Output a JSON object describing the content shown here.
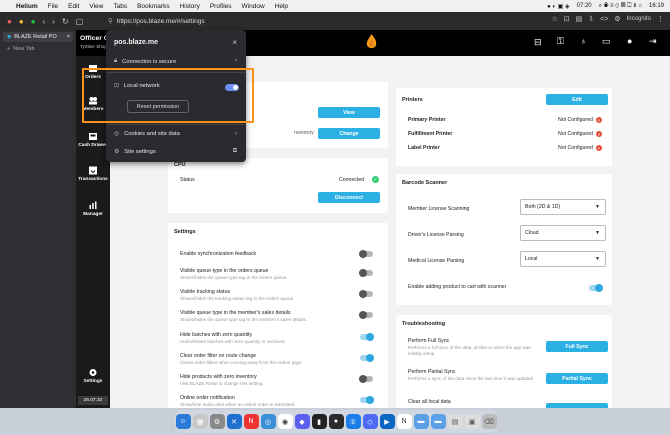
{
  "menubar": {
    "app": "Helium",
    "items": [
      "File",
      "Edit",
      "View",
      "Tabs",
      "Bookmarks",
      "History",
      "Profiles",
      "Window",
      "Help"
    ],
    "right": {
      "time_left": "07:20",
      "time_right": "16:19"
    }
  },
  "browser": {
    "url": "https://pos.blaze.me/#/settings",
    "profile": "Incognito",
    "tab_title": "BLAZE Retail PO",
    "new_tab": "New Tab"
  },
  "popup": {
    "site": "pos.blaze.me",
    "connection": "Connection is secure",
    "local_network": "Local network",
    "reset": "Reset permission",
    "cookies": "Cookies and site data",
    "site_settings": "Site settings"
  },
  "app": {
    "store_name": "Officer C",
    "store_sub": "Tymber Shop",
    "nav": {
      "orders": "Orders",
      "members": "Members",
      "cash_drawer": "Cash Drawer",
      "transactions": "Transactions",
      "manager": "Manager",
      "settings": "Settings",
      "version": "26.07.32"
    },
    "top_card": {
      "view": "View",
      "change": "Change",
      "inventory_text": "nventory"
    },
    "cpu": {
      "title": "CPU",
      "status_label": "Status",
      "status_value": "Connected",
      "disconnect": "Disconnect"
    },
    "settings": {
      "title": "Settings",
      "items": [
        {
          "label": "Enable synchronization feedback",
          "sub": "",
          "on": false
        },
        {
          "label": "Visible queue type in the orders queue",
          "sub": "Shows/hides the queue type tag in the orders queue.",
          "on": false
        },
        {
          "label": "Visible tracking status",
          "sub": "Shows/hides the tracking status tag in the orders queue.",
          "on": false
        },
        {
          "label": "Visible queue type in the member's sales details",
          "sub": "Shows/hides the queue type tag in the member's sales details.",
          "on": false
        },
        {
          "label": "Hide batches with zero quantity",
          "sub": "Hides/shows batches with zero quantity or archived.",
          "on": true
        },
        {
          "label": "Clear order filter on route change",
          "sub": "Clears order filters when moving away from the orders page",
          "on": true
        },
        {
          "label": "Hide products with zero inventory",
          "sub": "Visit BLAZE Retail to change this setting.",
          "on": false
        },
        {
          "label": "Online order notification",
          "sub": "Show/hide audio alert when an online order is submitted.",
          "on": true
        }
      ]
    },
    "printers": {
      "title": "Printers",
      "edit": "Edit",
      "rows": [
        {
          "label": "Primary Printer",
          "value": "Not Configured"
        },
        {
          "label": "Fulfillment Printer",
          "value": "Not Configured"
        },
        {
          "label": "Label Printer",
          "value": "Not Configured"
        }
      ]
    },
    "barcode": {
      "title": "Barcode Scanner",
      "rows": [
        {
          "label": "Member License Scanning",
          "value": "Both (2D & 1D)"
        },
        {
          "label": "Driver's License Parsing",
          "value": "Cloud"
        },
        {
          "label": "Medical License Parsing",
          "value": "Local"
        }
      ],
      "toggle_label": "Enable adding product to cart with scanner"
    },
    "troubleshooting": {
      "title": "Troubleshooting",
      "rows": [
        {
          "label": "Perform Full Sync",
          "sub": "Performs a full sync of the data, similar to when the app was initially setup",
          "button": "Full Sync"
        },
        {
          "label": "Perform Partial Sync",
          "sub": "Performs a sync of the data since the last time it was updated",
          "button": "Partial Sync"
        },
        {
          "label": "Clear all local data",
          "sub": "",
          "button": ""
        }
      ]
    }
  },
  "colors": {
    "accent": "#2bb0e4",
    "highlight": "#f7941d",
    "error": "#e74c3c",
    "success": "#2ecc71"
  }
}
